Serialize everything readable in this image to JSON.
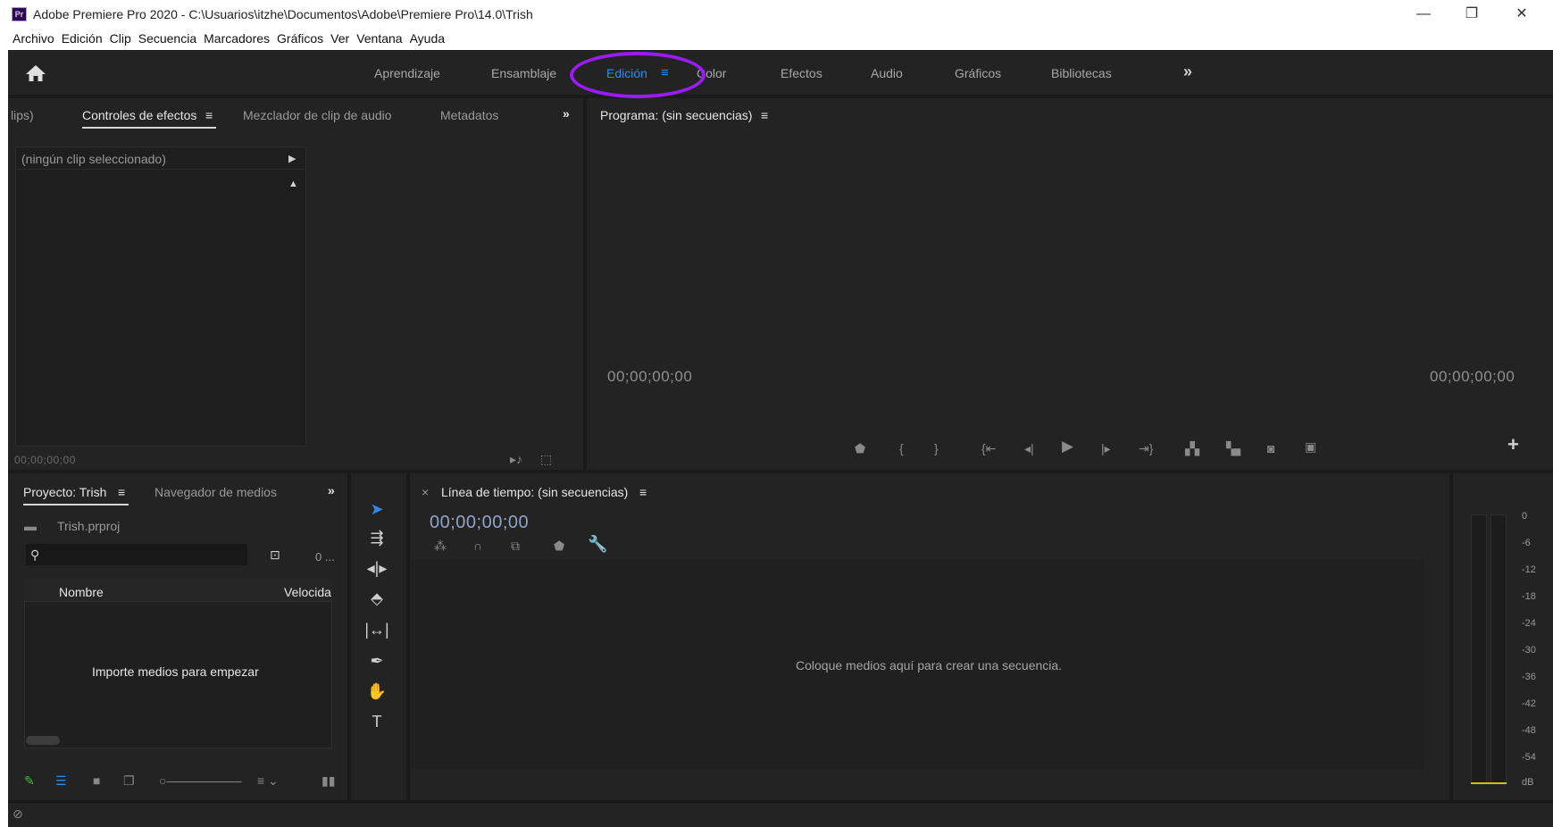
{
  "window": {
    "title": "Adobe Premiere Pro 2020 - C:\\Usuarios\\itzhe\\Documentos\\Adobe\\Premiere Pro\\14.0\\Trish",
    "logo_text": "Pr",
    "minimize": "—",
    "restore": "❐",
    "close": "✕"
  },
  "menu": [
    "Archivo",
    "Edición",
    "Clip",
    "Secuencia",
    "Marcadores",
    "Gráficos",
    "Ver",
    "Ventana",
    "Ayuda"
  ],
  "workspaces": {
    "tabs": [
      "Aprendizaje",
      "Ensamblaje",
      "Edición",
      "Color",
      "Efectos",
      "Audio",
      "Gráficos",
      "Bibliotecas"
    ],
    "active": "Edición",
    "menu_icon": "≡",
    "more": "»"
  },
  "source_panel": {
    "tab_clips": "lips)",
    "tab_effect_controls": "Controles de efectos",
    "tab_menu": "≡",
    "tab_audio_mixer": "Mezclador de clip de audio",
    "tab_metadata": "Metadatos",
    "more": "»",
    "no_clip": "(ningún clip seleccionado)",
    "timecode": "00;00;00;00"
  },
  "program_monitor": {
    "title": "Programa: (sin secuencias)",
    "menu": "≡",
    "timecode_left": "00;00;00;00",
    "timecode_right": "00;00;00;00",
    "add": "+"
  },
  "project_panel": {
    "tab_project": "Proyecto: Trish",
    "tab_menu": "≡",
    "tab_media_browser": "Navegador de medios",
    "more": "»",
    "project_file": "Trish.prproj",
    "count": "0 ...",
    "col_name": "Nombre",
    "col_speed": "Velocida",
    "empty_message": "Importe medios para empezar"
  },
  "timeline": {
    "close": "×",
    "title": "Línea de tiempo: (sin secuencias)",
    "menu": "≡",
    "timecode": "00;00;00;00",
    "drop_message": "Coloque medios aquí para crear una secuencia."
  },
  "audio_meter": {
    "scale": [
      "0",
      "-6",
      "-12",
      "-18",
      "-24",
      "-30",
      "-36",
      "-42",
      "-48",
      "-54",
      "dB"
    ]
  },
  "colors": {
    "accent": "#2d8ceb",
    "annotation": "#9b1cf3",
    "panel_bg": "#232323"
  }
}
